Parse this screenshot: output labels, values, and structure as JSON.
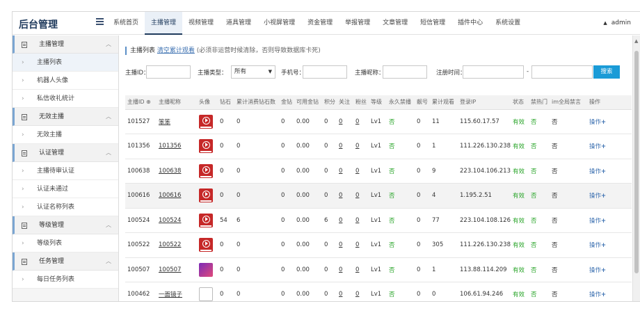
{
  "header": {
    "logo": "后台管理",
    "nav": [
      "系统首页",
      "主播管理",
      "视频管理",
      "道具管理",
      "小视屏管理",
      "资金管理",
      "举报管理",
      "文章管理",
      "短信管理",
      "插件中心",
      "系统设置"
    ],
    "active_nav_index": 1,
    "user": "admin"
  },
  "sidebar": {
    "groups": [
      {
        "label": "主播管理",
        "items": [
          "主播列表",
          "机器人头像",
          "私信收礼统计"
        ]
      },
      {
        "label": "无效主播",
        "items": [
          "无效主播"
        ]
      },
      {
        "label": "认证管理",
        "items": [
          "主播待审认证",
          "认证未通过",
          "认证名称列表"
        ]
      },
      {
        "label": "等级管理",
        "items": [
          "等级列表"
        ]
      },
      {
        "label": "任务管理",
        "items": [
          "每日任务列表"
        ]
      }
    ],
    "active_item": "主播列表"
  },
  "info": {
    "prefix": "主播列表",
    "clear_link": "清空累计观看",
    "hint": "(必须非运营时候清除，否则导致数据库卡死)"
  },
  "filters": {
    "anchor_id_label": "主播ID：",
    "anchor_type_label": "主播类型：",
    "anchor_type_value": "所有",
    "phone_label": "手机号：",
    "nickname_label": "主播昵称：",
    "register_label": "注册时间：",
    "range_sep": "-",
    "search_label": "搜索"
  },
  "table": {
    "columns": [
      "主播ID ⊕",
      "主播昵称",
      "头像",
      "钻石",
      "累计消费钻石数",
      "金钻",
      "可用金钻",
      "积分",
      "关注",
      "粉丝",
      "等级",
      "永久禁播",
      "靓号",
      "累计观看",
      "登录IP",
      "状态",
      "禁热门",
      "im全局禁言",
      "操作"
    ],
    "rows": [
      {
        "id": "101527",
        "nick": "笨笨",
        "avatar": "red",
        "diamond": "0",
        "consume": "0",
        "gold": "0",
        "avail": "0.00",
        "score": "0",
        "follow": "0",
        "fans": "0",
        "level": "Lv1",
        "ban": "否",
        "pretty": "0",
        "watch": "11",
        "ip": "115.60.17.57",
        "status": "有效",
        "hot": "否",
        "im": "否",
        "op": "操作"
      },
      {
        "id": "101356",
        "nick": "101356",
        "avatar": "red",
        "diamond": "0",
        "consume": "0",
        "gold": "0",
        "avail": "0.00",
        "score": "0",
        "follow": "0",
        "fans": "0",
        "level": "Lv1",
        "ban": "否",
        "pretty": "0",
        "watch": "1",
        "ip": "111.226.130.238",
        "status": "有效",
        "hot": "否",
        "im": "否",
        "op": "操作"
      },
      {
        "id": "100638",
        "nick": "100638",
        "avatar": "red",
        "diamond": "0",
        "consume": "0",
        "gold": "0",
        "avail": "0.00",
        "score": "0",
        "follow": "0",
        "fans": "0",
        "level": "Lv1",
        "ban": "否",
        "pretty": "0",
        "watch": "9",
        "ip": "223.104.106.213",
        "status": "有效",
        "hot": "否",
        "im": "否",
        "op": "操作"
      },
      {
        "id": "100616",
        "nick": "100616",
        "avatar": "red",
        "diamond": "0",
        "consume": "0",
        "gold": "0",
        "avail": "0.00",
        "score": "0",
        "follow": "0",
        "fans": "0",
        "level": "Lv1",
        "ban": "否",
        "pretty": "0",
        "watch": "4",
        "ip": "1.195.2.51",
        "status": "有效",
        "hot": "否",
        "im": "否",
        "op": "操作"
      },
      {
        "id": "100524",
        "nick": "100524",
        "avatar": "red",
        "diamond": "54",
        "consume": "6",
        "gold": "0",
        "avail": "0.00",
        "score": "6",
        "follow": "0",
        "fans": "0",
        "level": "Lv1",
        "ban": "否",
        "pretty": "0",
        "watch": "77",
        "ip": "223.104.108.126",
        "status": "有效",
        "hot": "否",
        "im": "否",
        "op": "操作"
      },
      {
        "id": "100522",
        "nick": "100522",
        "avatar": "red",
        "diamond": "0",
        "consume": "0",
        "gold": "0",
        "avail": "0.00",
        "score": "0",
        "follow": "0",
        "fans": "0",
        "level": "Lv1",
        "ban": "否",
        "pretty": "0",
        "watch": "305",
        "ip": "111.226.130.238",
        "status": "有效",
        "hot": "否",
        "im": "否",
        "op": "操作"
      },
      {
        "id": "100507",
        "nick": "100507",
        "avatar": "purple",
        "diamond": "0",
        "consume": "0",
        "gold": "0",
        "avail": "0.00",
        "score": "0",
        "follow": "0",
        "fans": "0",
        "level": "Lv1",
        "ban": "否",
        "pretty": "0",
        "watch": "1",
        "ip": "113.88.114.209",
        "status": "有效",
        "hot": "否",
        "im": "否",
        "op": "操作"
      },
      {
        "id": "100462",
        "nick": "一面镜子",
        "avatar": "broken",
        "diamond": "0",
        "consume": "0",
        "gold": "0",
        "avail": "0.00",
        "score": "0",
        "follow": "0",
        "fans": "0",
        "level": "Lv1",
        "ban": "否",
        "pretty": "0",
        "watch": "0",
        "ip": "106.61.94.246",
        "status": "有效",
        "hot": "否",
        "im": "否",
        "op": "操作"
      }
    ],
    "highlight_row_index": 3
  },
  "colors": {
    "accent": "#1f3a5c",
    "search_button": "#1a9bd7",
    "status_green": "#2aa52a",
    "link_blue": "#3a6fb0"
  }
}
